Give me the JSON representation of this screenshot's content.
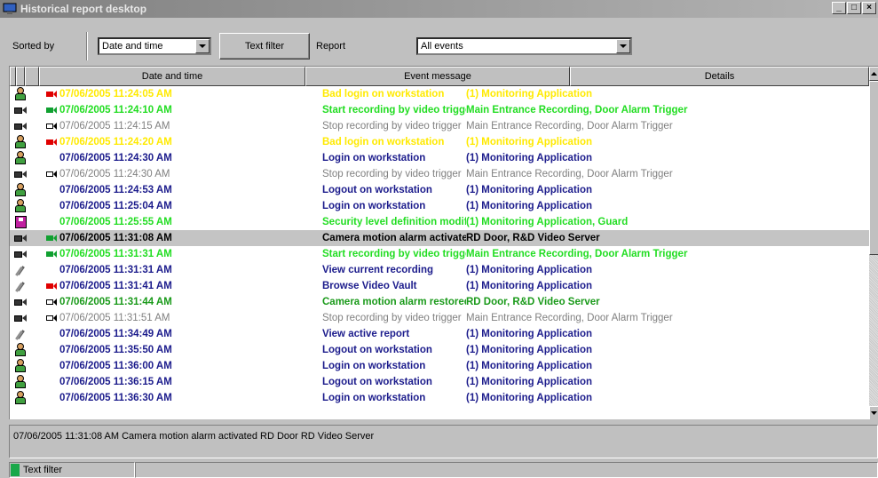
{
  "window": {
    "title": "Historical report desktop",
    "minimize": "_",
    "maximize": "□",
    "close": "×"
  },
  "toolbar": {
    "sorted_by_label": "Sorted by",
    "sort_value": "Date and time",
    "text_filter_button": "Text filter",
    "report_label": "Report",
    "report_value": "All events"
  },
  "grid": {
    "headers": [
      "",
      "",
      "",
      "Date and time",
      "Event message",
      "Details"
    ],
    "rows": [
      {
        "icon": "person-icon",
        "cam": "red",
        "date": "07/06/2005 11:24:05 AM",
        "message": "Bad login on workstation",
        "details": "(1) Monitoring Application",
        "color": "#ffea00",
        "bold": true
      },
      {
        "icon": "camera-icon",
        "cam": "green",
        "date": "07/06/2005 11:24:10 AM",
        "message": "Start recording by video trigger",
        "details": "Main Entrance Recording, Door Alarm Trigger",
        "color": "#22dd22",
        "bold": true
      },
      {
        "icon": "camera-icon",
        "cam": "gray",
        "date": "07/06/2005 11:24:15 AM",
        "message": "Stop recording by video trigger",
        "details": "Main Entrance Recording, Door Alarm Trigger",
        "color": "#808080",
        "bold": false
      },
      {
        "icon": "person-icon",
        "cam": "red",
        "date": "07/06/2005 11:24:20 AM",
        "message": "Bad login on workstation",
        "details": "(1) Monitoring Application",
        "color": "#ffea00",
        "bold": true
      },
      {
        "icon": "person-icon",
        "cam": "",
        "date": "07/06/2005 11:24:30 AM",
        "message": "Login on workstation",
        "details": "(1) Monitoring Application",
        "color": "#1c1c8c",
        "bold": true
      },
      {
        "icon": "camera-icon",
        "cam": "gray",
        "date": "07/06/2005 11:24:30 AM",
        "message": "Stop recording by video trigger",
        "details": "Main Entrance Recording, Door Alarm Trigger",
        "color": "#808080",
        "bold": false
      },
      {
        "icon": "person-icon",
        "cam": "",
        "date": "07/06/2005 11:24:53 AM",
        "message": "Logout on workstation",
        "details": "(1) Monitoring Application",
        "color": "#1c1c8c",
        "bold": true
      },
      {
        "icon": "person-icon",
        "cam": "",
        "date": "07/06/2005 11:25:04 AM",
        "message": "Login on workstation",
        "details": "(1) Monitoring Application",
        "color": "#1c1c8c",
        "bold": true
      },
      {
        "icon": "disk-icon",
        "cam": "",
        "date": "07/06/2005 11:25:55 AM",
        "message": "Security level definition modified",
        "details": "(1) Monitoring Application, Guard",
        "color": "#22dd22",
        "bold": true
      },
      {
        "icon": "camera-icon",
        "cam": "green",
        "date": "07/06/2005 11:31:08 AM",
        "message": "Camera motion alarm activated",
        "details": "RD Door, R&D Video Server",
        "color": "#000000",
        "bold": true,
        "selected": true
      },
      {
        "icon": "camera-icon",
        "cam": "green",
        "date": "07/06/2005 11:31:31 AM",
        "message": "Start recording by video trigger",
        "details": "Main Entrance Recording, Door Alarm Trigger",
        "color": "#22dd22",
        "bold": true
      },
      {
        "icon": "tools-icon",
        "cam": "",
        "date": "07/06/2005 11:31:31 AM",
        "message": "View current recording",
        "details": "(1) Monitoring Application",
        "color": "#1c1c8c",
        "bold": true
      },
      {
        "icon": "tools-icon",
        "cam": "red",
        "date": "07/06/2005 11:31:41 AM",
        "message": "Browse Video Vault",
        "details": "(1) Monitoring Application",
        "color": "#1c1c8c",
        "bold": true
      },
      {
        "icon": "camera-icon",
        "cam": "gray",
        "date": "07/06/2005 11:31:44 AM",
        "message": "Camera motion alarm restored",
        "details": "RD Door, R&D Video Server",
        "color": "#1a9a1a",
        "bold": true
      },
      {
        "icon": "camera-icon",
        "cam": "gray",
        "date": "07/06/2005 11:31:51 AM",
        "message": "Stop recording by video trigger",
        "details": "Main Entrance Recording, Door Alarm Trigger",
        "color": "#808080",
        "bold": false
      },
      {
        "icon": "tools-icon",
        "cam": "",
        "date": "07/06/2005 11:34:49 AM",
        "message": "View active report",
        "details": "(1) Monitoring Application",
        "color": "#1c1c8c",
        "bold": true
      },
      {
        "icon": "person-icon",
        "cam": "",
        "date": "07/06/2005 11:35:50 AM",
        "message": "Logout on workstation",
        "details": "(1) Monitoring Application",
        "color": "#1c1c8c",
        "bold": true
      },
      {
        "icon": "person-icon",
        "cam": "",
        "date": "07/06/2005 11:36:00 AM",
        "message": "Login on workstation",
        "details": "(1) Monitoring Application",
        "color": "#1c1c8c",
        "bold": true
      },
      {
        "icon": "person-icon",
        "cam": "",
        "date": "07/06/2005 11:36:15 AM",
        "message": "Logout on workstation",
        "details": "(1) Monitoring Application",
        "color": "#1c1c8c",
        "bold": true
      },
      {
        "icon": "person-icon",
        "cam": "",
        "date": "07/06/2005 11:36:30 AM",
        "message": "Login on workstation",
        "details": "(1) Monitoring Application",
        "color": "#1c1c8c",
        "bold": true
      }
    ]
  },
  "detail_pane": {
    "text": "07/06/2005 11:31:08 AM  Camera motion alarm activated  RD Door  RD Video Server"
  },
  "statusbar": {
    "label": "Text filter"
  }
}
